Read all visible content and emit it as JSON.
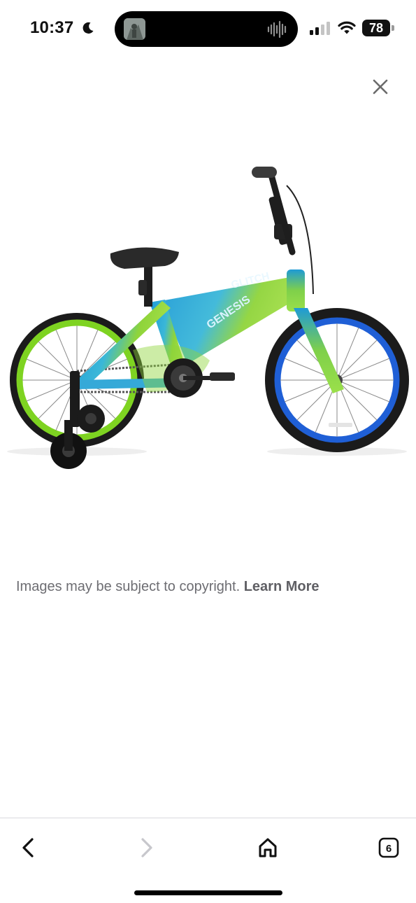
{
  "status_bar": {
    "time": "10:37",
    "battery_level": "78",
    "focus_icon": "moon-icon",
    "signal_icon": "cellular-signal-icon",
    "wifi_icon": "wifi-icon",
    "now_playing_icon": "audio-waveform-icon"
  },
  "viewer": {
    "close_icon": "close-icon",
    "image_subject": "bicycle-product-image",
    "bike_brand_text": "GENESIS",
    "bike_model_text": "GLITCH",
    "copyright_text": "Images may be subject to copyright.",
    "learn_more_label": "Learn More"
  },
  "toolbar": {
    "back_icon": "chevron-left-icon",
    "forward_icon": "chevron-right-icon",
    "home_icon": "home-icon",
    "tabs_count": "6",
    "forward_enabled": false
  },
  "colors": {
    "frame_blue": "#1e9ad6",
    "frame_green": "#8fd43a",
    "rim_green": "#7ed321",
    "rim_blue": "#1f5fd6",
    "caption_gray": "#6d6d72",
    "disabled_gray": "#c7c7cc"
  }
}
